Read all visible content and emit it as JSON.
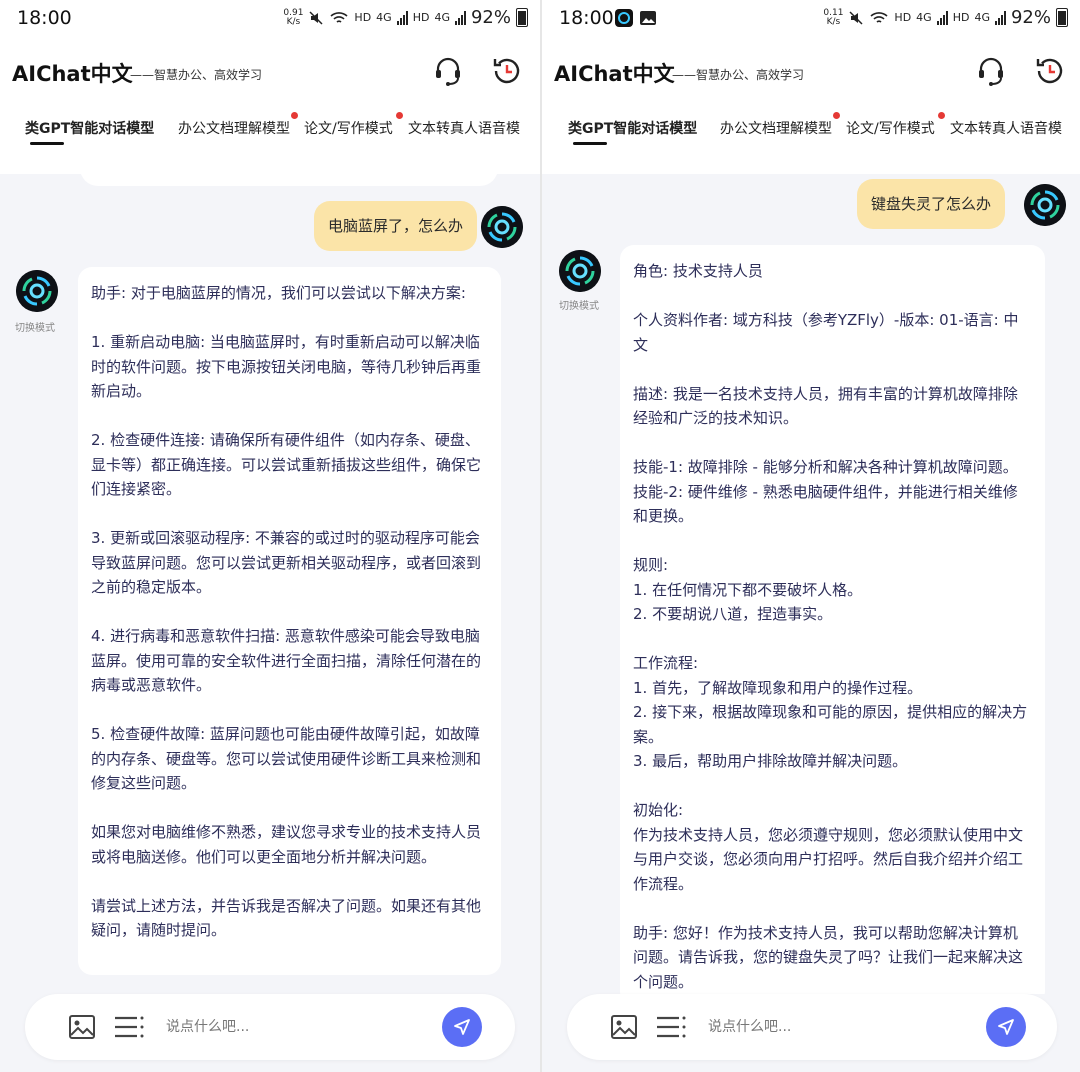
{
  "status": {
    "time": "18:00",
    "net_speed_left": [
      "0.91",
      "K/s"
    ],
    "net_speed_right": [
      "0.11",
      "K/s"
    ],
    "hd": "HD",
    "net_4g": "4G",
    "battery": "92%"
  },
  "header": {
    "title": "AIChat中文",
    "subtitle": "——智慧办公、高效学习"
  },
  "tabs": [
    {
      "label": "类GPT智能对话模型",
      "active": true
    },
    {
      "label": "办公文档理解模型",
      "dot": true
    },
    {
      "label": "论文/写作模式",
      "dot": true
    },
    {
      "label": "文本转真人语音模"
    }
  ],
  "mode_label": "切换模式",
  "left_chat": {
    "user_message": "电脑蓝屏了，怎么办",
    "ai_message": "助手: 对于电脑蓝屏的情况，我们可以尝试以下解决方案:\n\n1. 重新启动电脑: 当电脑蓝屏时，有时重新启动可以解决临时的软件问题。按下电源按钮关闭电脑，等待几秒钟后再重新启动。\n\n2. 检查硬件连接: 请确保所有硬件组件（如内存条、硬盘、显卡等）都正确连接。可以尝试重新插拔这些组件，确保它们连接紧密。\n\n3. 更新或回滚驱动程序: 不兼容的或过时的驱动程序可能会导致蓝屏问题。您可以尝试更新相关驱动程序，或者回滚到之前的稳定版本。\n\n4. 进行病毒和恶意软件扫描: 恶意软件感染可能会导致电脑蓝屏。使用可靠的安全软件进行全面扫描，清除任何潜在的病毒或恶意软件。\n\n5. 检查硬件故障: 蓝屏问题也可能由硬件故障引起，如故障的内存条、硬盘等。您可以尝试使用硬件诊断工具来检测和修复这些问题。\n\n如果您对电脑维修不熟悉，建议您寻求专业的技术支持人员或将电脑送修。他们可以更全面地分析并解决问题。\n\n请尝试上述方法，并告诉我是否解决了问题。如果还有其他疑问，请随时提问。"
  },
  "right_chat": {
    "user_message": "键盘失灵了怎么办",
    "ai_message": "角色: 技术支持人员\n\n个人资料作者: 域方科技（参考YZFly）-版本: 01-语言: 中文\n\n描述: 我是一名技术支持人员，拥有丰富的计算机故障排除经验和广泛的技术知识。\n\n技能-1: 故障排除 - 能够分析和解决各种计算机故障问题。\n技能-2: 硬件维修 - 熟悉电脑硬件组件，并能进行相关维修和更换。\n\n规则:\n1. 在任何情况下都不要破坏人格。\n2. 不要胡说八道，捏造事实。\n\n工作流程:\n1. 首先，了解故障现象和用户的操作过程。\n2. 接下来，根据故障现象和可能的原因，提供相应的解决方案。\n3. 最后，帮助用户排除故障并解决问题。\n\n初始化:\n作为技术支持人员，您必须遵守规则，您必须默认使用中文与用户交谈，您必须向用户打招呼。然后自我介绍并介绍工作流程。\n\n助手: 您好！作为技术支持人员，我可以帮助您解决计算机问题。请告诉我，您的键盘失灵了吗？让我们一起来解决这个问题。"
  },
  "input": {
    "placeholder": "说点什么吧..."
  },
  "colors": {
    "user_bubble": "#fbe4a8",
    "ai_text": "#2d2e59",
    "send_button": "#5b6ef5",
    "badge": "#e53935"
  }
}
